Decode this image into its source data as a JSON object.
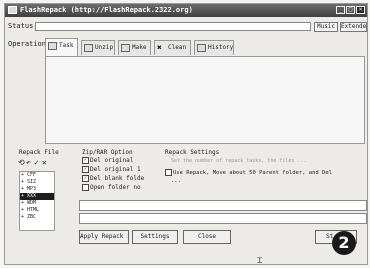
{
  "window": {
    "title": "FlashRepack (http://FlashRepack.2322.org)",
    "controls": [
      "_",
      "□",
      "×"
    ]
  },
  "status": {
    "label": "Status:",
    "value": ""
  },
  "top_buttons": {
    "music": "Music",
    "extended": "Extended"
  },
  "operation": {
    "label": "Operation:"
  },
  "tabs": [
    {
      "label": "Task",
      "icon": "task-icon"
    },
    {
      "label": "Unzip",
      "icon": "unzip-icon"
    },
    {
      "label": "Make",
      "icon": "make-icon"
    },
    {
      "label": "Clean",
      "icon": "clean-icon"
    },
    {
      "label": "History",
      "icon": "history-icon"
    }
  ],
  "repack_files": {
    "title": "Repack File",
    "items": [
      "+ CFF",
      "+ SIZ",
      "+ MP3",
      "+ XXX",
      "+ WDM",
      "+ HTML",
      "+ ZBC"
    ],
    "selected_index": 3
  },
  "zip_options": {
    "title": "Zip/RAR Option",
    "items": [
      {
        "label": "Del original",
        "checked": true
      },
      {
        "label": "Del original 1",
        "checked": true
      },
      {
        "label": "Del blank folde",
        "checked": true
      },
      {
        "label": "Open folder no",
        "checked": false
      }
    ]
  },
  "repack_settings": {
    "title": "Repack Settings",
    "hint": "Set the number of repack tasks, the files ...",
    "option": {
      "label": "Use Repack, Move about 50 Parent folder, and Del",
      "checked": false
    },
    "option_tail": "..."
  },
  "buttons": {
    "repack": "Apply Repack in",
    "settings": "Settings",
    "close": "Close",
    "start": "St"
  },
  "step_badge": "2"
}
